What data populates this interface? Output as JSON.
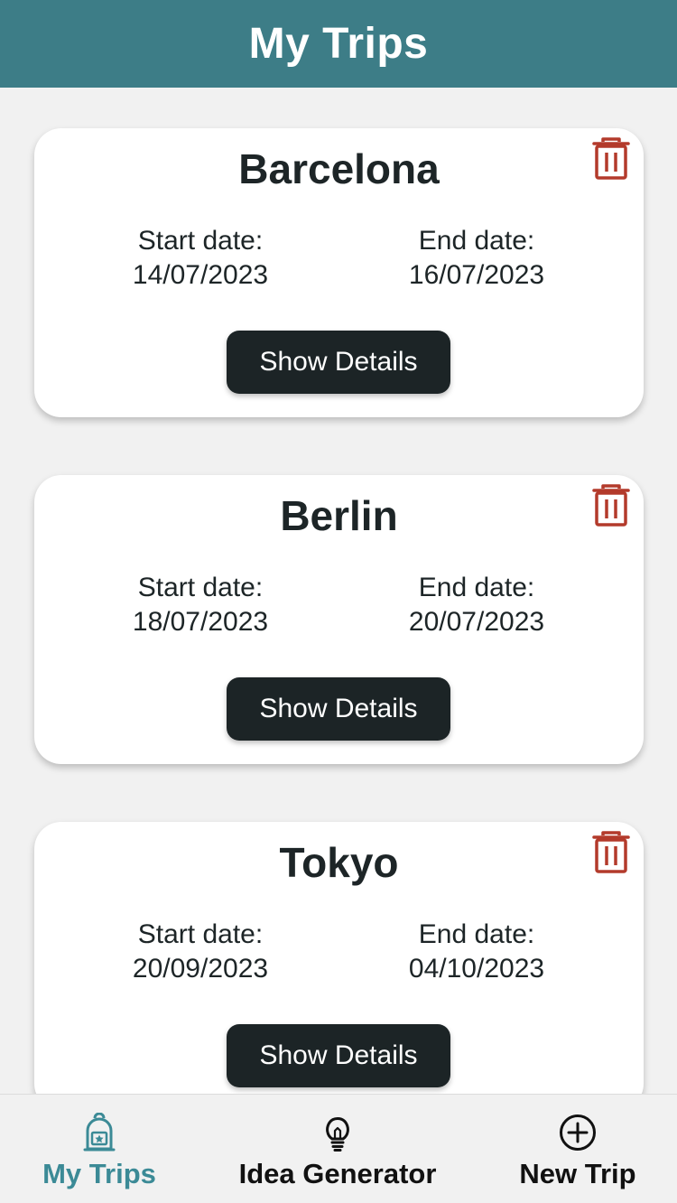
{
  "header": {
    "title": "My Trips"
  },
  "trips": [
    {
      "name": "Barcelona",
      "start_label": "Start date:",
      "start_date": "14/07/2023",
      "end_label": "End date:",
      "end_date": "16/07/2023",
      "button_label": "Show Details",
      "delete_icon": "trash-icon"
    },
    {
      "name": "Berlin",
      "start_label": "Start date:",
      "start_date": "18/07/2023",
      "end_label": "End date:",
      "end_date": "20/07/2023",
      "button_label": "Show Details",
      "delete_icon": "trash-icon"
    },
    {
      "name": "Tokyo",
      "start_label": "Start date:",
      "start_date": "20/09/2023",
      "end_label": "End date:",
      "end_date": "04/10/2023",
      "button_label": "Show Details",
      "delete_icon": "trash-icon"
    }
  ],
  "bottom_nav": {
    "items": [
      {
        "label": "My Trips",
        "icon": "backpack-icon",
        "active": true
      },
      {
        "label": "Idea Generator",
        "icon": "lightbulb-icon",
        "active": false
      },
      {
        "label": "New Trip",
        "icon": "add-circle-icon",
        "active": false
      }
    ]
  },
  "colors": {
    "header_bg": "#3d7d87",
    "accent": "#3b8a96",
    "delete": "#b33a2b",
    "button_bg": "#1c2426",
    "text_dark": "#1d2527",
    "background": "#f1f1f1"
  }
}
